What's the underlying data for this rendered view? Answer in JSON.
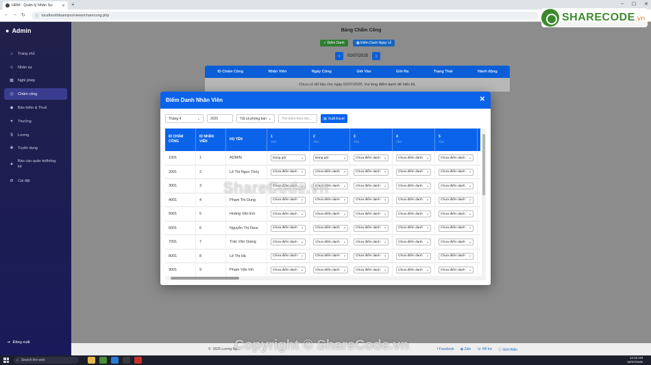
{
  "browser": {
    "tab_title": "HRM - Quản lý Nhân Sự",
    "url": "localhost/doannjno/views/chamcong.php"
  },
  "watermark": {
    "logo_main": "SHARECODE",
    "logo_suffix": ".vn",
    "center": "ShareCode.vn",
    "bottom": "Copyright © ShareCode.vn"
  },
  "sidebar": {
    "brand": "Admin",
    "items": [
      {
        "label": "Trang chủ",
        "icon": "home-icon"
      },
      {
        "label": "Nhân sự",
        "icon": "users-icon"
      },
      {
        "label": "Nghỉ phép",
        "icon": "calendar-icon"
      },
      {
        "label": "Chấm công",
        "icon": "clock-icon"
      },
      {
        "label": "Bảo hiểm & Thuế",
        "icon": "shield-icon"
      },
      {
        "label": "Thưởng",
        "icon": "gift-icon"
      },
      {
        "label": "Lương",
        "icon": "money-icon"
      },
      {
        "label": "Tuyển dụng",
        "icon": "user-plus-icon"
      },
      {
        "label": "Báo cáo quản trị/thống kê",
        "icon": "chart-icon"
      },
      {
        "label": "Cài đặt",
        "icon": "gear-icon"
      }
    ],
    "logout": "Đăng xuất"
  },
  "page": {
    "title": "Bảng Chấm Công",
    "btn_attendance": "Điểm Danh",
    "btn_holiday": "Điểm Danh Ngày Lễ",
    "date": "02/07/2025",
    "columns": [
      "ID Chấm Công",
      "Nhân Viên",
      "Ngày Công",
      "Giờ Vào",
      "Giờ Ra",
      "Trạng Thái",
      "Hành động"
    ],
    "empty_msg": "Chưa có dữ liệu cho ngày 02/07/2025. Vui lòng điểm danh để hiển thị."
  },
  "footer": {
    "copyright": "2025 Lương Ng...",
    "links": [
      "Facebook",
      "Zalo",
      "Hỗ trợ",
      "Giới thiệu"
    ]
  },
  "modal": {
    "title": "Điểm Danh Nhân Viên",
    "month": "Tháng 4",
    "year": "2025",
    "department": "Tất cả phòng ban",
    "search_placeholder": "Tìm kiếm theo tên...",
    "export": "Xuất Excel",
    "headers": [
      "ID CHẤM CÔNG",
      "ID NHÂN VIÊN",
      "HỌ TÊN"
    ],
    "day_headers": [
      {
        "day": "1",
        "weekday": "Thứ"
      },
      {
        "day": "2",
        "weekday": "Thứ"
      },
      {
        "day": "3",
        "weekday": "Thứ"
      },
      {
        "day": "4",
        "weekday": "Thứ"
      },
      {
        "day": "5",
        "weekday": "Thứ"
      }
    ],
    "rows": [
      {
        "id": "1001",
        "emp": "1",
        "name": "ADMIN",
        "days": [
          "Đúng giờ",
          "Đúng giờ",
          "Chưa điểm danh",
          "Chưa điểm danh",
          "Chưa điểm danh"
        ]
      },
      {
        "id": "2001",
        "emp": "2",
        "name": "Lê Thị Ngọc Thủy",
        "days": [
          "Chưa điểm danh",
          "Chưa điểm danh",
          "Chưa điểm danh",
          "Chưa điểm danh",
          "Chưa điểm danh"
        ]
      },
      {
        "id": "3001",
        "emp": "3",
        "name": "",
        "days": [
          "Chưa điểm danh",
          "Chưa điểm danh",
          "Chưa điểm danh",
          "Chưa điểm danh",
          "Chưa điểm danh"
        ]
      },
      {
        "id": "4001",
        "emp": "4",
        "name": "Phạm Thị Dung",
        "days": [
          "Chưa điểm danh",
          "Chưa điểm danh",
          "Chưa điểm danh",
          "Chưa điểm danh",
          "Chưa điểm danh"
        ]
      },
      {
        "id": "5001",
        "emp": "5",
        "name": "Hoàng Văn Em",
        "days": [
          "Chưa điểm danh",
          "Chưa điểm danh",
          "Chưa điểm danh",
          "Chưa điểm danh",
          "Chưa điểm danh"
        ]
      },
      {
        "id": "6001",
        "emp": "6",
        "name": "Nguyễn Thị Fleur",
        "days": [
          "Chưa điểm danh",
          "Chưa điểm danh",
          "Chưa điểm danh",
          "Chưa điểm danh",
          "Chưa điểm danh"
        ]
      },
      {
        "id": "7001",
        "emp": "7",
        "name": "Trần Văn Giang",
        "days": [
          "Chưa điểm danh",
          "Chưa điểm danh",
          "Chưa điểm danh",
          "Chưa điểm danh",
          "Chưa điểm danh"
        ]
      },
      {
        "id": "8001",
        "emp": "8",
        "name": "Lê Thị Hà",
        "days": [
          "Chưa điểm danh",
          "Chưa điểm danh",
          "Chưa điểm danh",
          "Chưa điểm danh",
          "Chưa điểm danh"
        ]
      },
      {
        "id": "9001",
        "emp": "9",
        "name": "Phạm Văn Inh",
        "days": [
          "Chưa điểm danh",
          "Chưa điểm danh",
          "Chưa điểm danh",
          "Chưa điểm danh",
          "Chưa điểm danh"
        ]
      }
    ]
  },
  "taskbar": {
    "search": "Search the web",
    "time": "12:42 AM",
    "date": "02/07/2025"
  }
}
